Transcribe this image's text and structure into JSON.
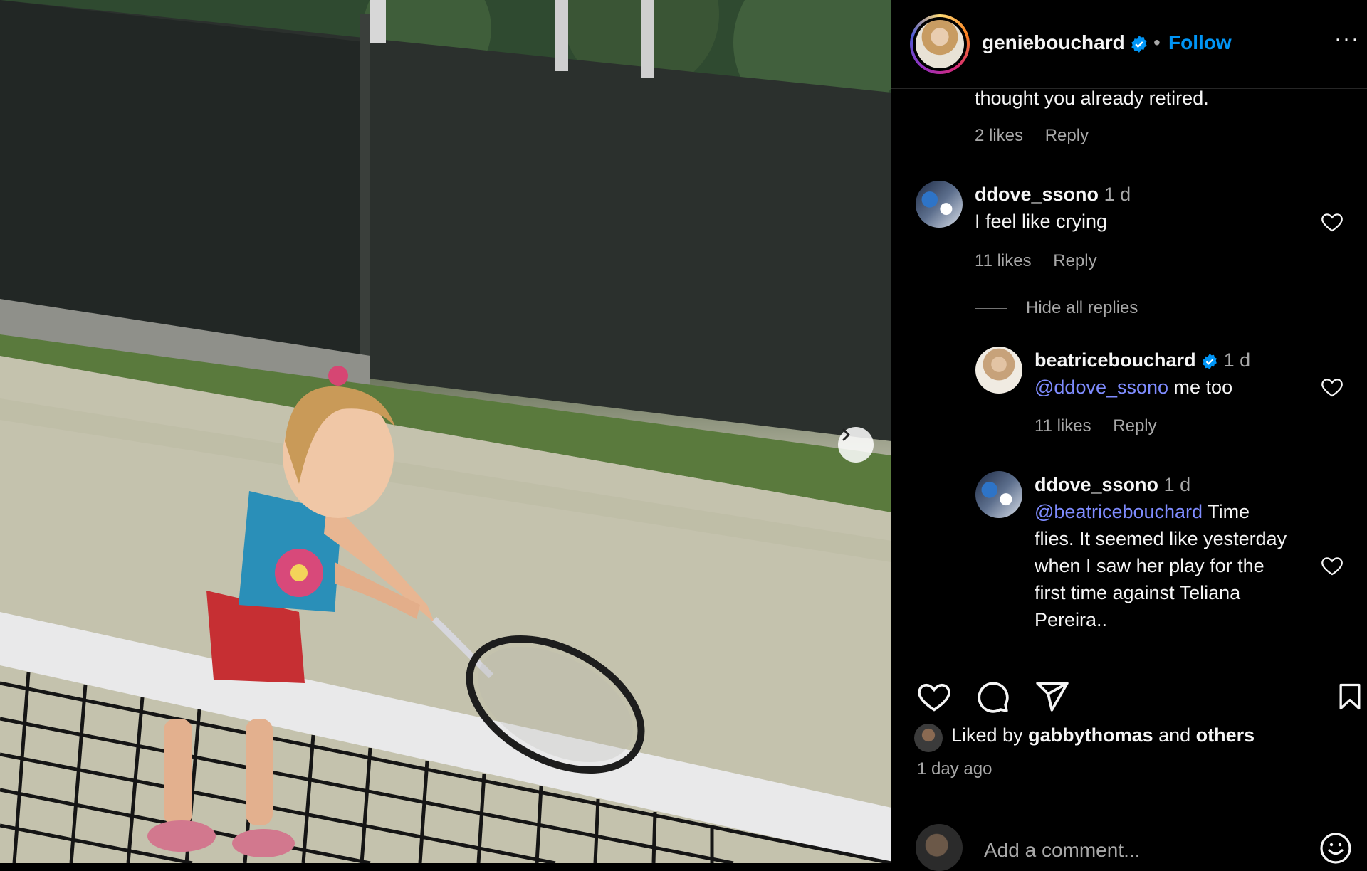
{
  "post": {
    "author": "geniebouchard",
    "follow_label": "Follow",
    "dot": "•",
    "more_label": "···"
  },
  "comments": {
    "partial_text": "thought you already retired.",
    "partial_meta": {
      "likes": "2 likes",
      "reply": "Reply"
    },
    "c1": {
      "user": "ddove_ssono",
      "time": "1 d",
      "text": "I feel like crying",
      "likes": "11 likes",
      "reply": "Reply"
    },
    "hide_replies": "Hide all replies",
    "r1": {
      "user": "beatricebouchard",
      "time": "1 d",
      "mention": "@ddove_ssono",
      "text": " me too",
      "likes": "11 likes",
      "reply": "Reply"
    },
    "r2": {
      "user": "ddove_ssono",
      "time": "1 d",
      "mention": "@beatricebouchard",
      "text_line1": " Time",
      "lines": [
        "flies. It seemed like yesterday",
        "when I saw her play for the",
        "first time against Teliana",
        "Pereira.."
      ]
    }
  },
  "engagement": {
    "liked_prefix": "Liked by ",
    "liked_user": "gabbythomas",
    "liked_and": " and ",
    "liked_others": "others",
    "time_ago": "1 day ago"
  },
  "composer": {
    "placeholder": "Add a comment..."
  },
  "colors": {
    "link": "#0095f6",
    "mention": "#7f8cff",
    "muted": "#a8a8a8",
    "verified": "#0095f6"
  }
}
